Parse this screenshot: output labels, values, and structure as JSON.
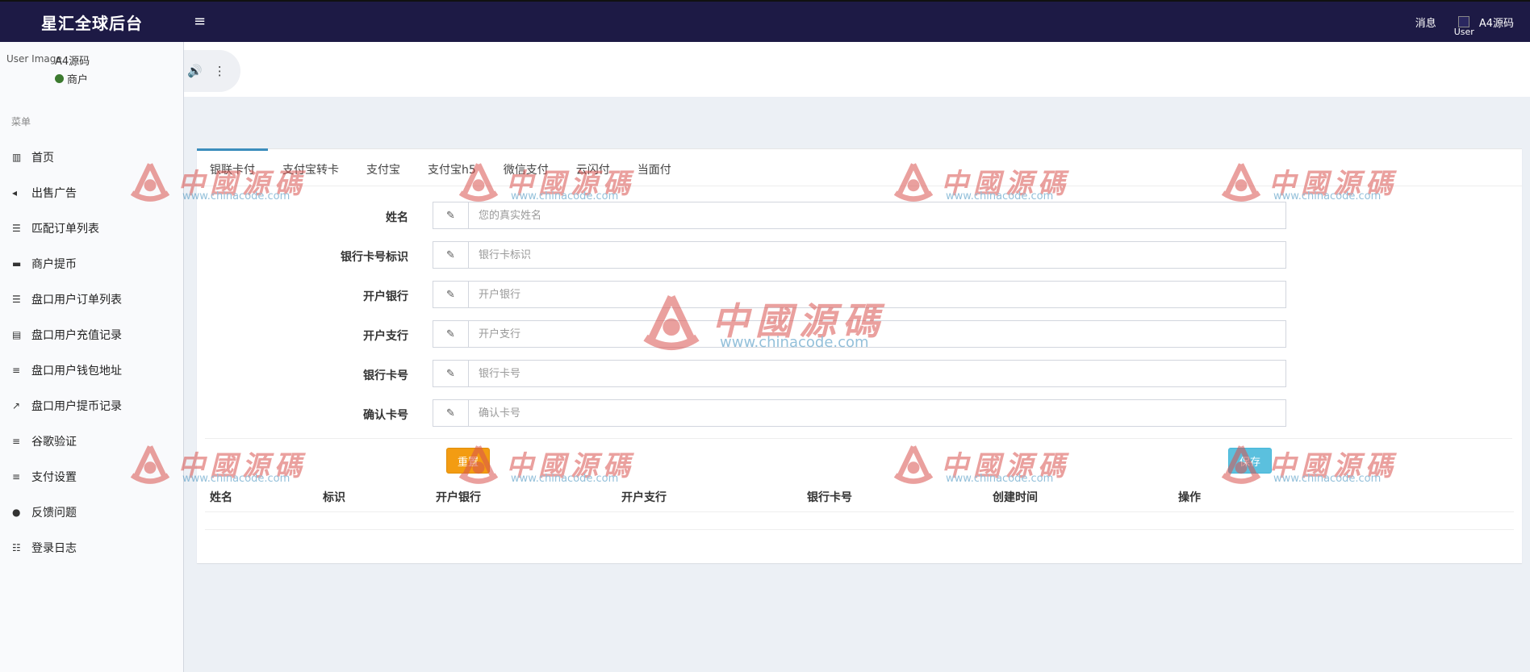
{
  "app": {
    "brand": "星汇全球后台",
    "menu_toggle": "≡"
  },
  "topbar": {
    "messages": "消息",
    "user_img_alt": "User",
    "username": "A4源码"
  },
  "sidebar": {
    "user_img_alt": "User Image",
    "username": "A4源码",
    "status": "商户",
    "menu_header": "菜单",
    "items": [
      {
        "label": "首页",
        "icon": "bar-chart-icon",
        "glyph": "▥"
      },
      {
        "label": "出售广告",
        "icon": "bullhorn-icon",
        "glyph": "◂"
      },
      {
        "label": "匹配订单列表",
        "icon": "list-icon",
        "glyph": "☰"
      },
      {
        "label": "商户提币",
        "icon": "credit-card-icon",
        "glyph": "▬"
      },
      {
        "label": "盘口用户订单列表",
        "icon": "list-icon",
        "glyph": "☰"
      },
      {
        "label": "盘口用户充值记录",
        "icon": "clipboard-icon",
        "glyph": "▤"
      },
      {
        "label": "盘口用户钱包地址",
        "icon": "bars-icon",
        "glyph": "≡"
      },
      {
        "label": "盘口用户提币记录",
        "icon": "external-link-icon",
        "glyph": "↗"
      },
      {
        "label": "谷歌验证",
        "icon": "bars-icon",
        "glyph": "≡"
      },
      {
        "label": "支付设置",
        "icon": "bars-icon",
        "glyph": "≡"
      },
      {
        "label": "反馈问题",
        "icon": "comment-icon",
        "glyph": "●"
      },
      {
        "label": "登录日志",
        "icon": "list-ol-icon",
        "glyph": "☷"
      }
    ]
  },
  "content_top": {
    "audio_icon": "🔊",
    "more_icon": "⋮"
  },
  "tabs": [
    "银联卡付",
    "支付宝转卡",
    "支付宝",
    "支付宝h5",
    "微信支付",
    "云闪付",
    "当面付"
  ],
  "form": {
    "fields": [
      {
        "label": "姓名",
        "placeholder": "您的真实姓名"
      },
      {
        "label": "银行卡号标识",
        "placeholder": "银行卡标识"
      },
      {
        "label": "开户银行",
        "placeholder": "开户银行"
      },
      {
        "label": "开户支行",
        "placeholder": "开户支行"
      },
      {
        "label": "银行卡号",
        "placeholder": "银行卡号"
      },
      {
        "label": "确认卡号",
        "placeholder": "确认卡号"
      }
    ],
    "reset_label": "重置",
    "save_label": "保存"
  },
  "table": {
    "headers": [
      "姓名",
      "标识",
      "开户银行",
      "开户支行",
      "银行卡号",
      "创建时间",
      "操作"
    ]
  },
  "watermark": {
    "text": "中國源碼",
    "url": "www.chinacode.com"
  },
  "colors": {
    "topbar": "#1d1a45",
    "accent": "#3c8dbc",
    "reset": "#f39c12",
    "save": "#5bc0de",
    "status": "#3c7a2f"
  }
}
